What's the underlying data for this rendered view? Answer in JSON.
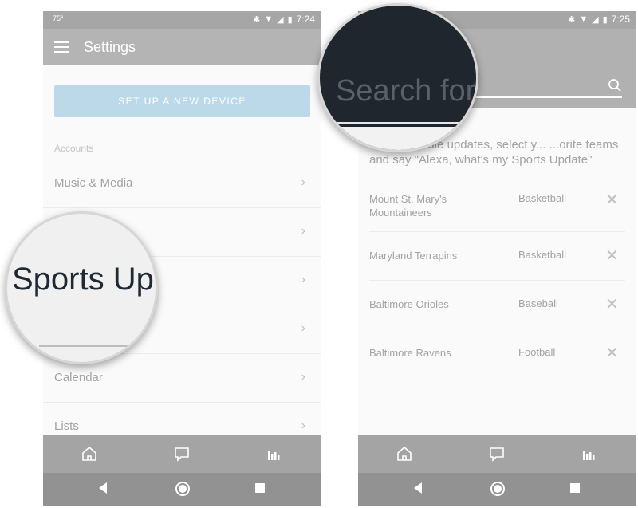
{
  "left_screen": {
    "status": {
      "temperature": "75°",
      "time": "7:24"
    },
    "app_title": "Settings",
    "setup_button": "SET UP A NEW DEVICE",
    "section_label": "Accounts",
    "rows": [
      {
        "label": "Music & Media"
      },
      {
        "label": ""
      },
      {
        "label": ""
      },
      {
        "label": ""
      },
      {
        "label": "Calendar"
      },
      {
        "label": "Lists"
      }
    ],
    "magnifier_text": "Sports Up"
  },
  "right_screen": {
    "status": {
      "time": "7:25"
    },
    "magnifier_text": "Search for",
    "intro": "...nd schedule updates, select y... ...orite teams and say \"Alexa, what's my Sports Update\"",
    "teams": [
      {
        "name": "Mount St. Mary's Mountaineers",
        "sport": "Basketball"
      },
      {
        "name": "Maryland Terrapins",
        "sport": "Basketball"
      },
      {
        "name": "Baltimore Orioles",
        "sport": "Baseball"
      },
      {
        "name": "Baltimore Ravens",
        "sport": "Football"
      }
    ]
  },
  "icons": {
    "bottom_nav": [
      "home-icon",
      "chat-icon",
      "music-bars-icon"
    ],
    "system_nav": [
      "back-icon",
      "home-circle-icon",
      "recents-icon"
    ]
  }
}
